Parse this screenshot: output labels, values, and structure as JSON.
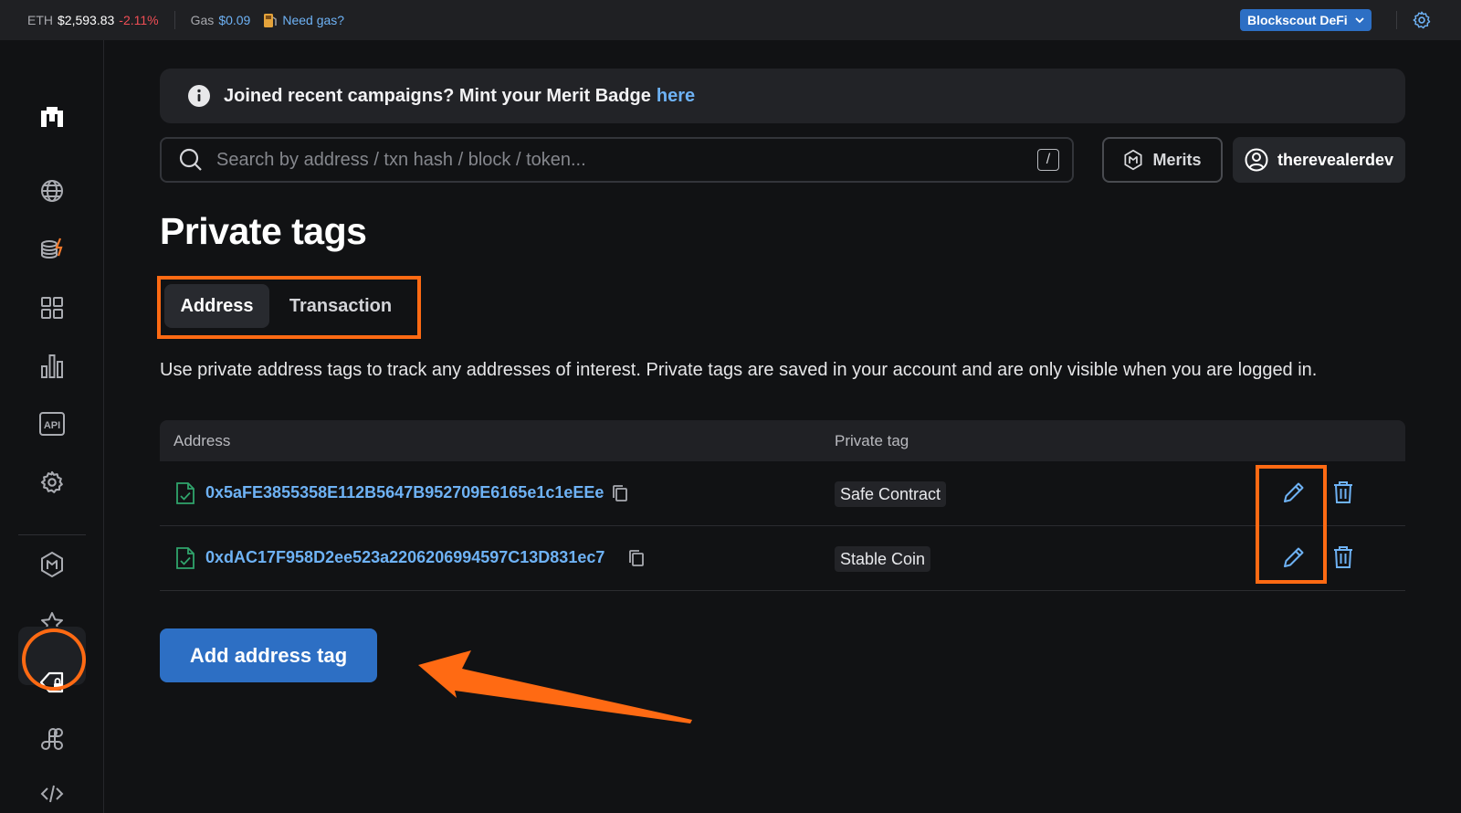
{
  "topbar": {
    "eth_label": "ETH",
    "eth_price": "$2,593.83",
    "eth_change": "-2.11%",
    "gas_label": "Gas",
    "gas_price": "$0.09",
    "need_gas": "Need gas?",
    "network": "Blockscout DeFi"
  },
  "banner": {
    "text": "Joined recent campaigns? Mint your Merit Badge",
    "link": "here"
  },
  "search": {
    "placeholder": "Search by address / txn hash / block / token...",
    "shortcut": "/"
  },
  "header": {
    "merits_label": "Merits",
    "username": "therevealerdev"
  },
  "page": {
    "title": "Private tags",
    "tabs": [
      {
        "label": "Address",
        "active": true
      },
      {
        "label": "Transaction",
        "active": false
      }
    ],
    "description": "Use private address tags to track any addresses of interest. Private tags are saved in your account and are only visible when you are logged in."
  },
  "table": {
    "columns": [
      "Address",
      "Private tag"
    ],
    "rows": [
      {
        "address": "0x5aFE3855358E112B5647B952709E6165e1c1eEEe",
        "tag": "Safe Contract"
      },
      {
        "address": "0xdAC17F958D2ee523a2206206994597C13D831ec7",
        "tag": "Stable Coin"
      }
    ]
  },
  "add_button": "Add address tag",
  "sidebar": {
    "icons": [
      "logo-icon",
      "globe-icon",
      "coins-icon",
      "grid-icon",
      "chart-icon",
      "api-icon",
      "gear-icon",
      "merits-icon",
      "star-icon",
      "private-tag-icon",
      "apps-icon",
      "code-icon"
    ]
  },
  "colors": {
    "accent": "#2d6fc4",
    "link": "#6eb2f5",
    "highlight": "#ff6a13",
    "negative": "#f04e55"
  }
}
